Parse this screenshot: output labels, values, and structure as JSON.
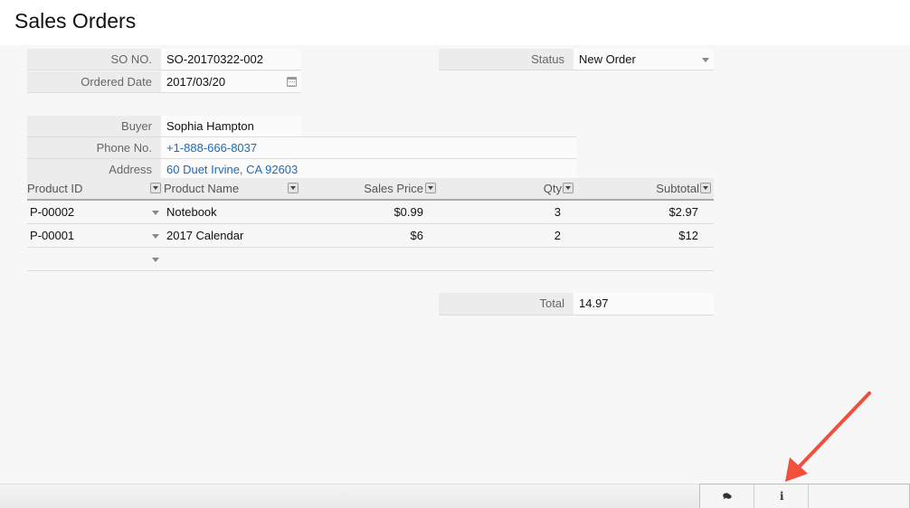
{
  "page": {
    "title": "Sales Orders"
  },
  "form": {
    "so_no": {
      "label": "SO NO.",
      "value": "SO-20170322-002"
    },
    "ordered_date": {
      "label": "Ordered Date",
      "value": "2017/03/20"
    },
    "status": {
      "label": "Status",
      "value": "New Order"
    },
    "buyer": {
      "label": "Buyer",
      "value": "Sophia Hampton"
    },
    "phone": {
      "label": "Phone No.",
      "value": "+1-888-666-8037"
    },
    "address": {
      "label": "Address",
      "value": "60 Duet Irvine, CA 92603"
    }
  },
  "table": {
    "columns": [
      "Product ID",
      "Product Name",
      "Sales Price",
      "Qty",
      "Subtotal"
    ],
    "rows": [
      {
        "product_id": "P-00002",
        "product_name": "Notebook",
        "sales_price": "$0.99",
        "qty": "3",
        "subtotal": "$2.97"
      },
      {
        "product_id": "P-00001",
        "product_name": "2017 Calendar",
        "sales_price": "$6",
        "qty": "2",
        "subtotal": "$12"
      }
    ]
  },
  "total": {
    "label": "Total",
    "value": "14.97"
  },
  "toolbar": {
    "icons": [
      "comments-icon",
      "info-icon"
    ]
  },
  "colors": {
    "link": "#1e6bb8",
    "annotation_arrow": "#f0503c"
  }
}
